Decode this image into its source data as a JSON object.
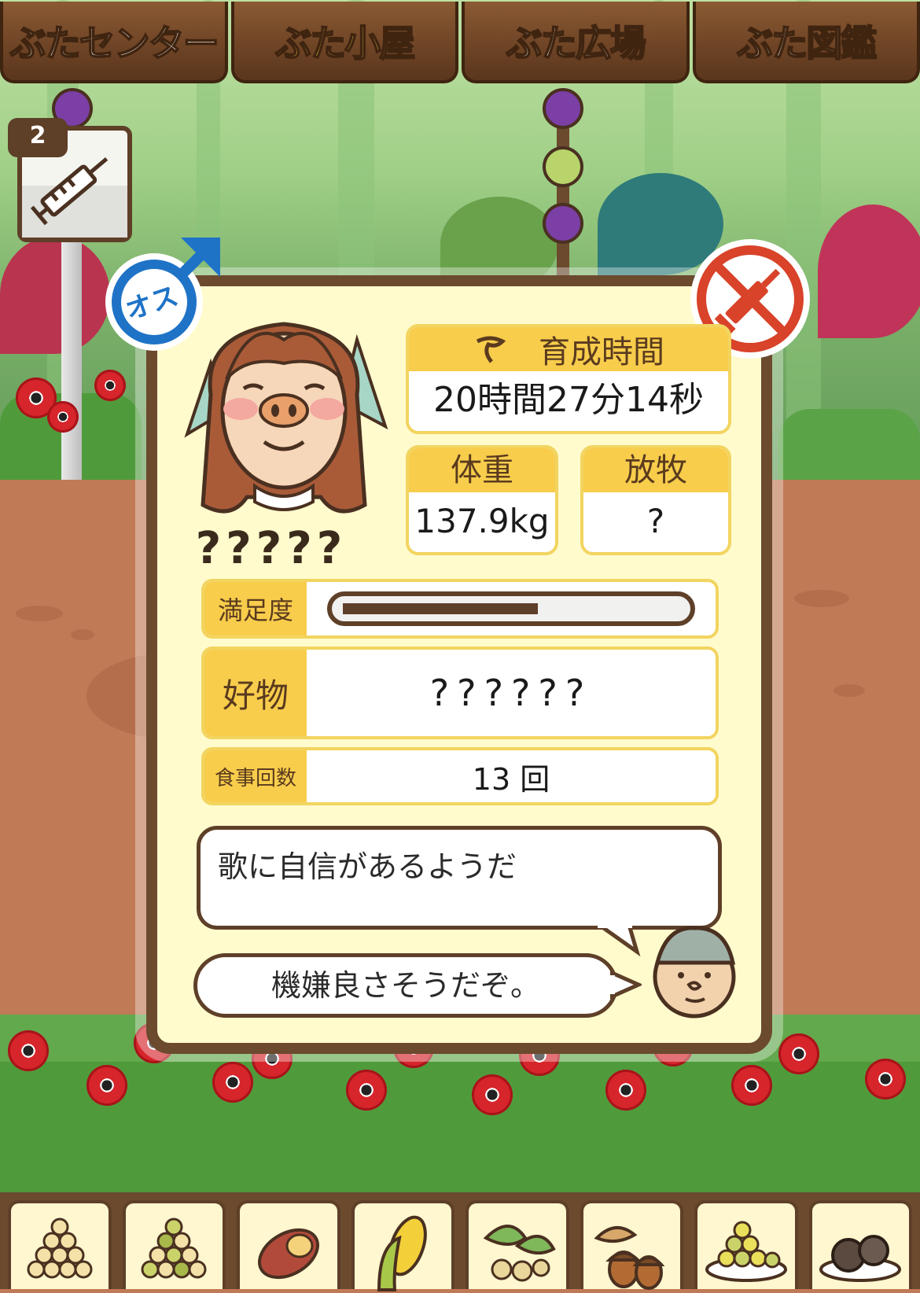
{
  "nav": {
    "tabs": [
      {
        "label": "ぶたセンター",
        "active": false
      },
      {
        "label": "ぶた小屋",
        "active": true
      },
      {
        "label": "ぶた広場",
        "active": false
      },
      {
        "label": "ぶた図鑑",
        "active": false
      }
    ]
  },
  "item": {
    "count": "2",
    "icon": "syringe-icon"
  },
  "pig": {
    "gender_label": "オス",
    "name": "?????",
    "growth_time_label": "育成時間",
    "growth_time": "20時間27分14秒",
    "weight_label": "体重",
    "weight": "137.9kg",
    "grazing_label": "放牧",
    "grazing": "?",
    "satisfaction_label": "満足度",
    "satisfaction_fraction": 0.58,
    "favorite_label": "好物",
    "favorite": "??????",
    "meals_label": "食事回数",
    "meals": "13 回",
    "trait_text": "歌に自信があるようだ",
    "keeper_comment": "機嫌良さそうだぞ。"
  },
  "food_items": [
    {
      "icon": "grain-pile-icon"
    },
    {
      "icon": "mixed-grain-icon"
    },
    {
      "icon": "sweet-potato-icon"
    },
    {
      "icon": "corn-icon"
    },
    {
      "icon": "herbs-nuts-icon"
    },
    {
      "icon": "acorn-icon"
    },
    {
      "icon": "feed-plate-icon"
    },
    {
      "icon": "truffle-plate-icon"
    }
  ],
  "colors": {
    "card_bg": "#fffbcd",
    "card_border": "#6b4a2e",
    "accent_yellow": "#f8cd4c",
    "male_blue": "#1f73c7",
    "no_medicine_red": "#d8432a"
  }
}
